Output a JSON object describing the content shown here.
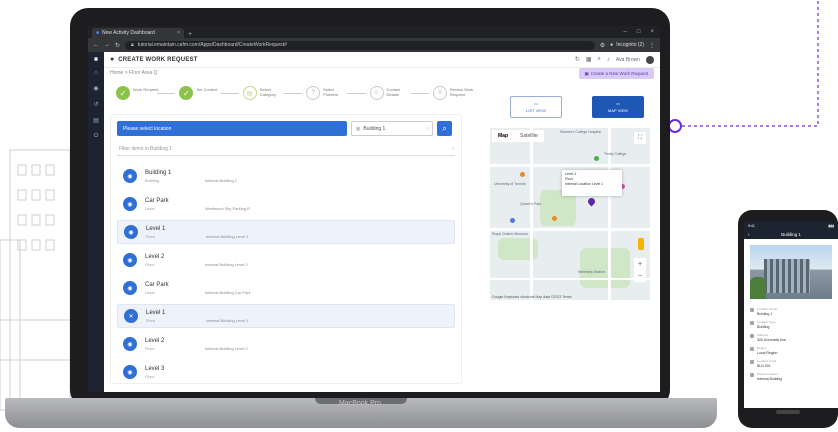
{
  "browser": {
    "tab_title": "New Activity Dashboard",
    "url": "tutorial.emaintain.cafm.com/Apps/Dashboard/CreateWorkRequest#",
    "incognito_label": "Incognito (2)"
  },
  "header": {
    "title": "CREATE WORK REQUEST",
    "user": "Ava Brown",
    "breadcrumb": "Home  >  Floor Area Q"
  },
  "prompt_button": "Create a New Work Request",
  "steps": [
    {
      "label": "Work Request",
      "state": "done"
    },
    {
      "label": "Set Context",
      "state": "done"
    },
    {
      "label": "Select Category",
      "state": "current"
    },
    {
      "label": "Select Problem",
      "state": "todo"
    },
    {
      "label": "Contact Details",
      "state": "todo"
    },
    {
      "label": "Review Work Request",
      "state": "todo"
    }
  ],
  "search": {
    "placeholder": "Please select location",
    "building_value": "Building 1",
    "filter_placeholder": "Filter items in Building 1"
  },
  "locations": [
    {
      "name": "Building 1",
      "type": "Building",
      "path": "Internal Building 1",
      "selected": false
    },
    {
      "name": "Car Park",
      "type": "Level",
      "path": "Westwood Sky Parking R",
      "selected": false
    },
    {
      "name": "Level 1",
      "type": "Floor",
      "path": "Internal Building Level 1",
      "selected": true
    },
    {
      "name": "Level 2",
      "type": "Floor",
      "path": "Internal Building Level 2",
      "selected": false
    },
    {
      "name": "Car Park",
      "type": "Level",
      "path": "Internal Building Car Park",
      "selected": false
    },
    {
      "name": "Level 1",
      "type": "Floor",
      "path": "Internal Building Level 1",
      "selected": true
    },
    {
      "name": "Level 2",
      "type": "Floor",
      "path": "Internal Building Level 2",
      "selected": false
    },
    {
      "name": "Level 3",
      "type": "Floor",
      "path": "",
      "selected": false
    }
  ],
  "view_buttons": [
    {
      "label": "LIST VIEW",
      "active": false
    },
    {
      "label": "MAP VIEW",
      "active": true
    }
  ],
  "map": {
    "tabs": [
      "Map",
      "Satellite"
    ],
    "popup_lines": [
      "Level 1",
      "Floor",
      "Internal Location Level 1"
    ],
    "labels": [
      "Women's College Hospital",
      "Trinity College",
      "University of Toronto",
      "Queen's Park",
      "Royal Ontario Museum",
      "Wellesley Station"
    ],
    "footer": "Google   Keyboard shortcuts   Map data ©2023   Terms"
  },
  "phone": {
    "time": "9:41",
    "title": "Building 1",
    "details": [
      {
        "key": "Location Name",
        "value": "Building 1"
      },
      {
        "key": "Location Type",
        "value": "Building"
      },
      {
        "key": "Address",
        "value": "300 University Ave"
      },
      {
        "key": "Region",
        "value": "Local Region"
      },
      {
        "key": "Location Code",
        "value": "BLD-001"
      },
      {
        "key": "Parent Location",
        "value": "Internal Building"
      }
    ]
  },
  "laptop_brand": "MacBook Pro",
  "colors": {
    "accent": "#2f6fd6",
    "step_done": "#8bc34a",
    "rail": "#1b2430",
    "connector": "#6a2bd9"
  }
}
